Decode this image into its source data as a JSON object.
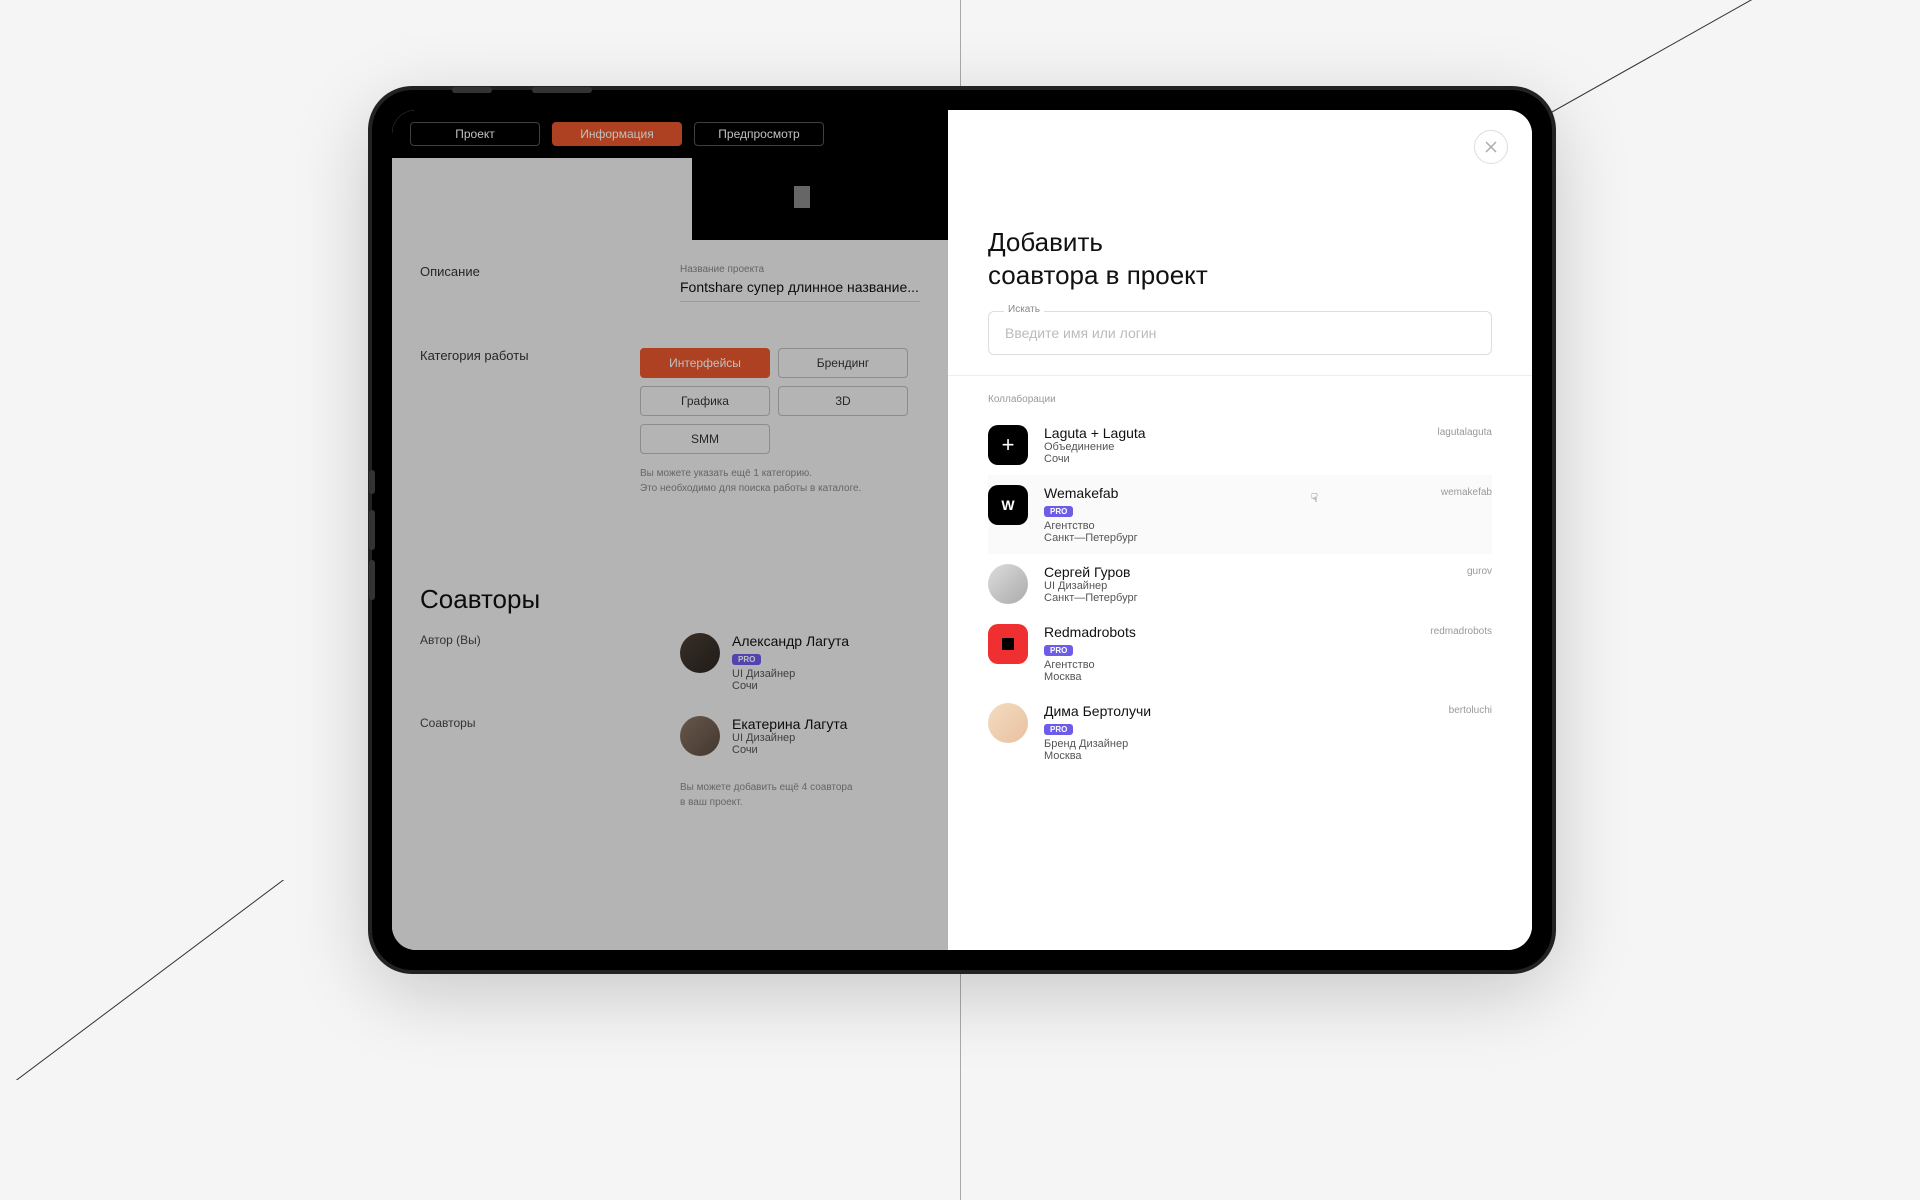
{
  "tabs": {
    "project": "Проект",
    "info": "Информация",
    "preview": "Предпросмотр"
  },
  "sections": {
    "description_label": "Описание",
    "project_name_label": "Название проекта",
    "project_name_value": "Fontshare супер длинное название...",
    "category_label": "Категория работы",
    "categories": [
      "Интерфейсы",
      "Брендинг",
      "Графика",
      "3D",
      "SMM"
    ],
    "category_hint1": "Вы можете указать ещё 1 категорию.",
    "category_hint2": "Это необходимо для поиска работы в каталоге.",
    "coauthors_title": "Соавторы",
    "author_label": "Автор (Вы)",
    "coauthors_label": "Соавторы",
    "coauthors_hint1": "Вы можете добавить ещё 4 соавтора",
    "coauthors_hint2": "в ваш проект."
  },
  "authors": [
    {
      "name": "Александр Лагута",
      "pro": "PRO",
      "role": "UI Дизайнер",
      "city": "Сочи"
    },
    {
      "name": "Екатерина Лагута",
      "role": "UI Дизайнер",
      "city": "Сочи"
    }
  ],
  "modal": {
    "title_l1": "Добавить",
    "title_l2": "соавтора в проект",
    "search_label": "Искать",
    "search_placeholder": "Введите имя или логин",
    "collab_heading": "Коллаборации"
  },
  "collaborators": [
    {
      "name": "Laguta + Laguta",
      "username": "lagutalaguta",
      "type": "Объединение",
      "city": "Сочи"
    },
    {
      "name": "Wemakefab",
      "username": "wemakefab",
      "pro": "PRO",
      "type": "Агентство",
      "city": "Санкт—Петербург"
    },
    {
      "name": "Сергей Гуров",
      "username": "gurov",
      "type": "UI Дизайнер",
      "city": "Санкт—Петербург"
    },
    {
      "name": "Redmadrobots",
      "username": "redmadrobots",
      "pro": "PRO",
      "type": "Агентство",
      "city": "Москва"
    },
    {
      "name": "Дима Бертолучи",
      "username": "bertoluchi",
      "pro": "PRO",
      "type": "Бренд Дизайнер",
      "city": "Москва"
    }
  ]
}
